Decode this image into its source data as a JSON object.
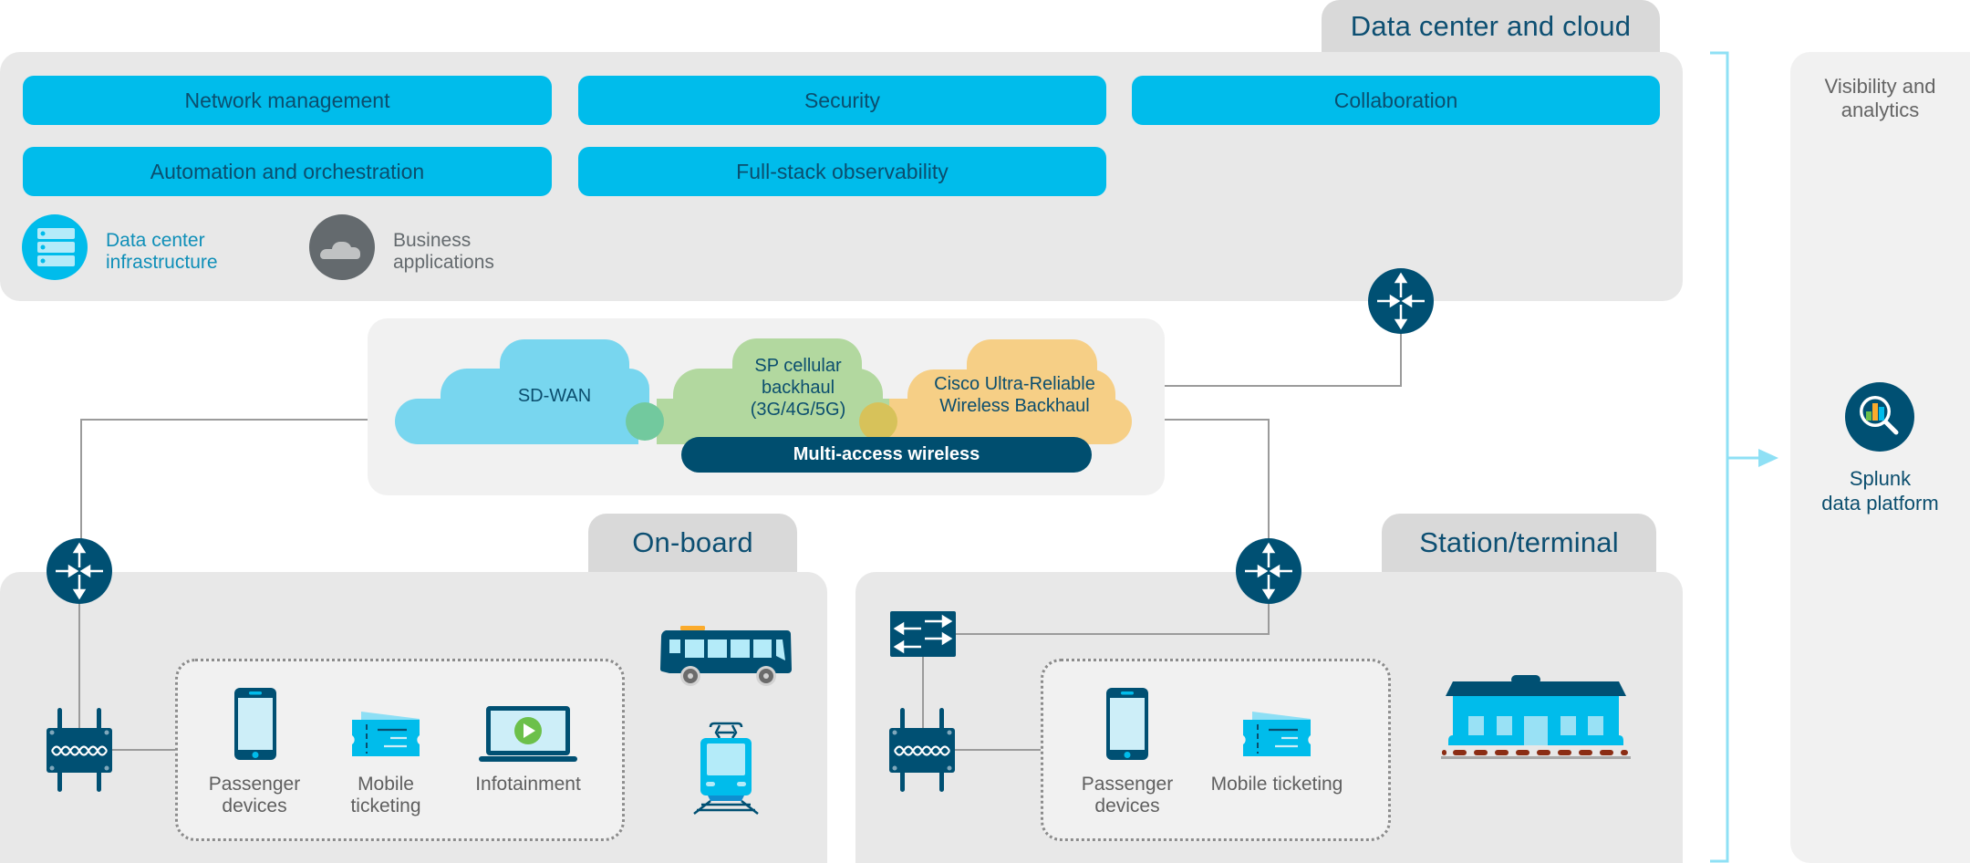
{
  "data_center": {
    "tab_label": "Data center and cloud",
    "capabilities": [
      {
        "label": "Network management"
      },
      {
        "label": "Security"
      },
      {
        "label": "Collaboration"
      },
      {
        "label": "Automation and orchestration"
      },
      {
        "label": "Full-stack observability"
      }
    ],
    "legend": [
      {
        "icon": "server-stack-icon",
        "label_line1": "Data center",
        "label_line2": "infrastructure",
        "color": "#00bceb"
      },
      {
        "icon": "cloud-icon",
        "label_line1": "Business",
        "label_line2": "applications",
        "color": "#646a6e"
      }
    ]
  },
  "wan": {
    "clouds": [
      {
        "label": "SD-WAN",
        "color": "#78d6ef"
      },
      {
        "label_line1": "SP cellular",
        "label_line2": "backhaul",
        "label_line3": "(3G/4G/5G)",
        "color": "#b2d89f"
      },
      {
        "label_line1": "Cisco Ultra-Reliable",
        "label_line2": "Wireless Backhaul",
        "color": "#f6cf86"
      }
    ],
    "multi_access_label": "Multi-access wireless"
  },
  "onboard": {
    "tab_label": "On-board",
    "devices": [
      {
        "icon": "smartphone-icon",
        "label_line1": "Passenger",
        "label_line2": "devices"
      },
      {
        "icon": "ticket-icon",
        "label_line1": "Mobile",
        "label_line2": "ticketing"
      },
      {
        "icon": "laptop-play-icon",
        "label_line1": "Infotainment",
        "label_line2": ""
      }
    ],
    "vehicles": [
      "bus-icon",
      "tram-icon"
    ]
  },
  "station": {
    "tab_label": "Station/terminal",
    "devices": [
      {
        "icon": "smartphone-icon",
        "label_line1": "Passenger",
        "label_line2": "devices"
      },
      {
        "icon": "ticket-icon",
        "label_line1": "Mobile ticketing",
        "label_line2": ""
      }
    ],
    "building": "station-building-icon"
  },
  "visibility": {
    "title_line1": "Visibility and",
    "title_line2": "analytics",
    "platform_line1": "Splunk",
    "platform_line2": "data platform"
  },
  "colors": {
    "accent": "#00bceb",
    "dark_blue": "#005073",
    "panel": "#e8e8e8",
    "tab": "#d9d9d9",
    "bracket": "#8fe0f5"
  }
}
